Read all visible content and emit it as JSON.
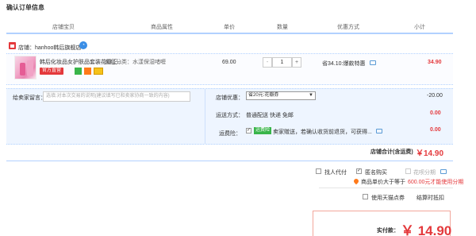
{
  "page": {
    "title": "确认订单信息"
  },
  "columns": {
    "store_item": "店铺宝贝",
    "attrs": "商品属性",
    "unit_price": "单价",
    "qty": "数量",
    "promo": "优惠方式",
    "subtotal": "小计"
  },
  "store": {
    "label": "店铺：hanhoo韩后旗舰店",
    "chat_icon": "wangwang-icon"
  },
  "item": {
    "name": "韩后化妆品女护肤品套装花瓣正...",
    "attr": "颜色分类：水漾保湿啫喱",
    "badges": {
      "official": "官方直营",
      "b1": "7",
      "b2": "保"
    },
    "price": "69.00",
    "qty_minus": "-",
    "qty": "1",
    "qty_plus": "+",
    "promo": "省34.10:爆款特惠",
    "subtotal": "34.90"
  },
  "options": {
    "message_label": "给卖家留言：",
    "message_placeholder": "选填:对本次交易的说明(建议填写已和卖家协商一致的内容)",
    "shop_discount_label": "店铺优惠：",
    "shop_discount_value": "省20元:花瓣券",
    "shop_discount_amount": "-20.00",
    "shipping_label": "运送方式：",
    "shipping_value": "普通配送 快递 免邮",
    "shipping_price": "0.00",
    "insurance_label": "运费险：",
    "insurance_badge": "运费险",
    "insurance_text": "卖家赠送，若确认收货前退货，可获得...",
    "insurance_price": "0.00"
  },
  "store_total": {
    "label": "店铺合计(含运费)",
    "amount": "￥14.90"
  },
  "checkout": {
    "pay_for_others": "找人代付",
    "anonymous": "匿名购买",
    "anonymous_checked": true,
    "installment": "花呗分期",
    "installment_note": "商品单价大于等于",
    "installment_amount": "600.00元才能使用分期",
    "tmall_coupon": "使用天猫点券",
    "settle_link": "结算时抵扣"
  },
  "payment": {
    "label": "实付款：",
    "amount": "￥ 14.90"
  },
  "colors": {
    "accent_red": "#e4393c",
    "border_blue": "#b2d1ff",
    "option_bg": "#eef5ff"
  }
}
